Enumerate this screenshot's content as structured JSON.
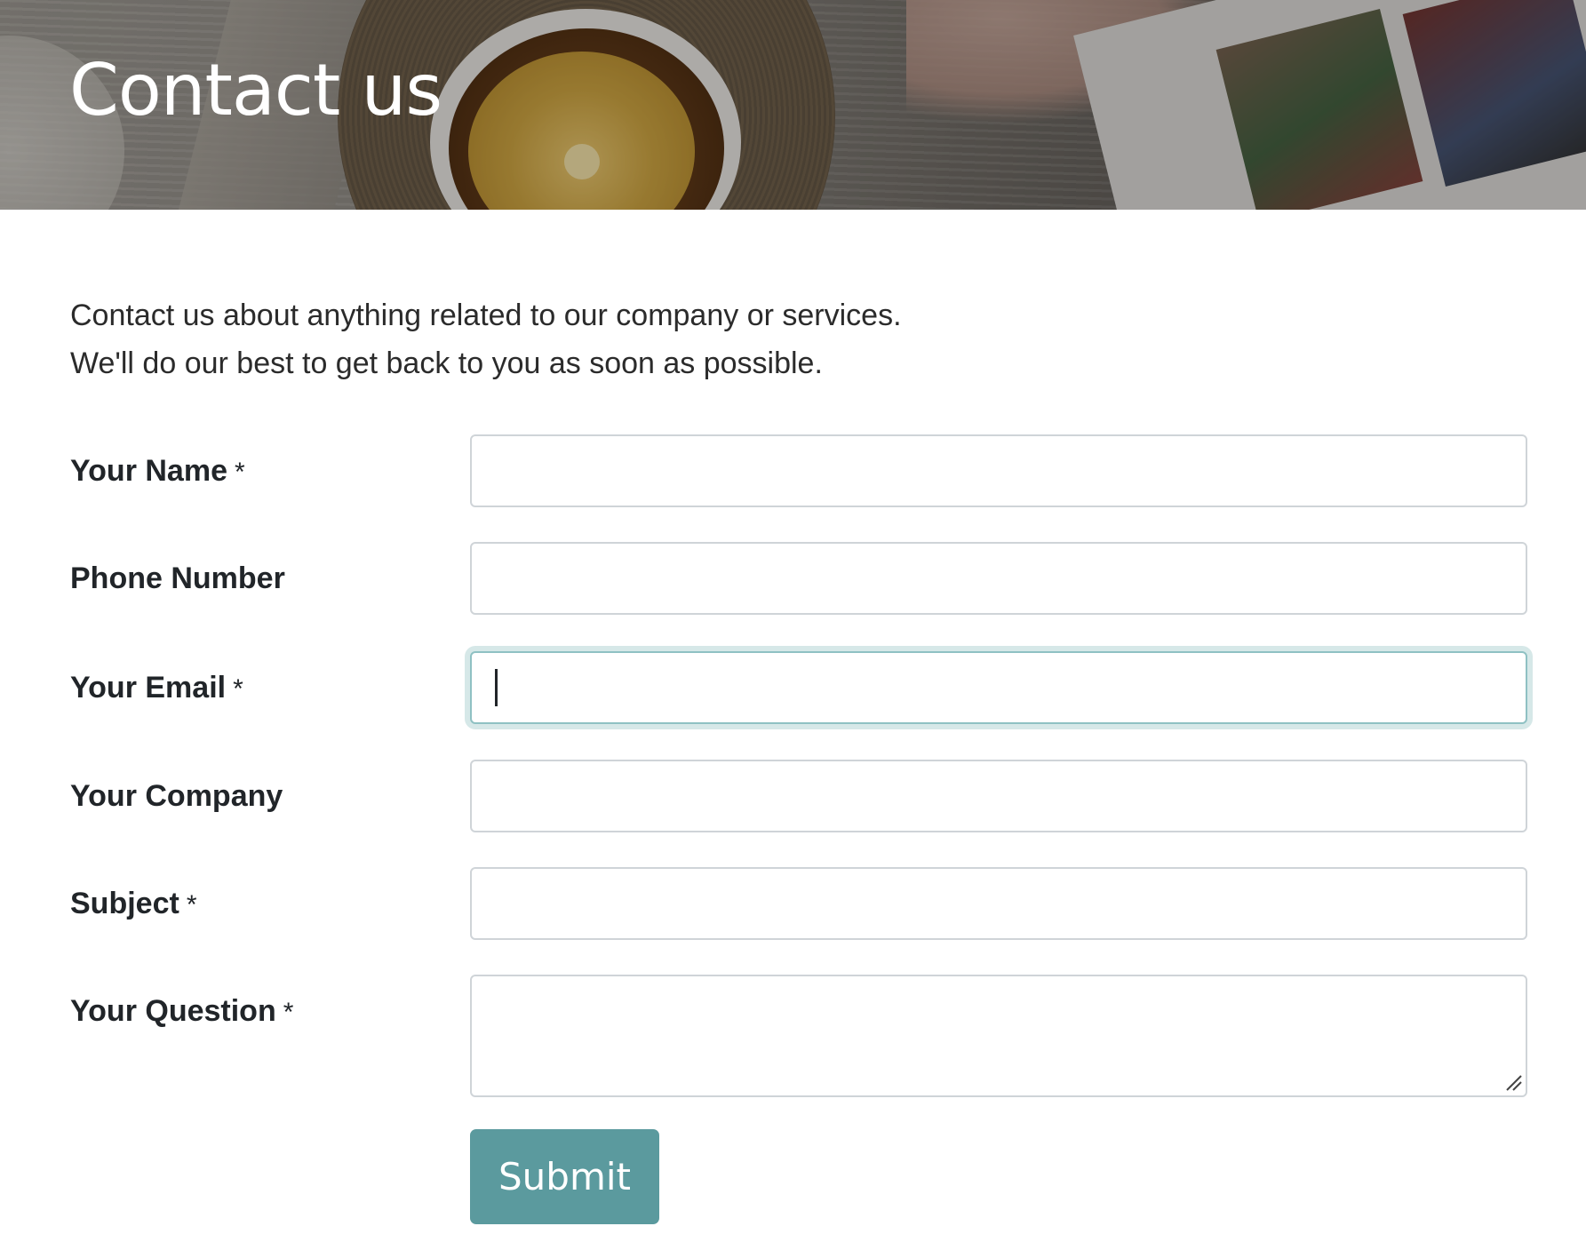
{
  "banner": {
    "title": "Contact us"
  },
  "intro": {
    "line1": "Contact us about anything related to our company or services.",
    "line2": "We'll do our best to get back to you as soon as possible."
  },
  "form": {
    "required_marker": "*",
    "fields": [
      {
        "label": "Your Name",
        "required": true,
        "value": "",
        "focused": false
      },
      {
        "label": "Phone Number",
        "required": false,
        "value": "",
        "focused": false
      },
      {
        "label": "Your Email",
        "required": true,
        "value": "",
        "focused": true
      },
      {
        "label": "Your Company",
        "required": false,
        "value": "",
        "focused": false
      },
      {
        "label": "Subject",
        "required": true,
        "value": "",
        "focused": false
      },
      {
        "label": "Your Question",
        "required": true,
        "value": "",
        "focused": false
      }
    ],
    "submit_label": "Submit"
  },
  "colors": {
    "accent": "#5b9a9e",
    "focus_ring": "#d6e8e8",
    "input_border": "#cfd4d8",
    "text": "#212529"
  },
  "icons": {
    "textarea_resize": "resize-grip-icon"
  }
}
